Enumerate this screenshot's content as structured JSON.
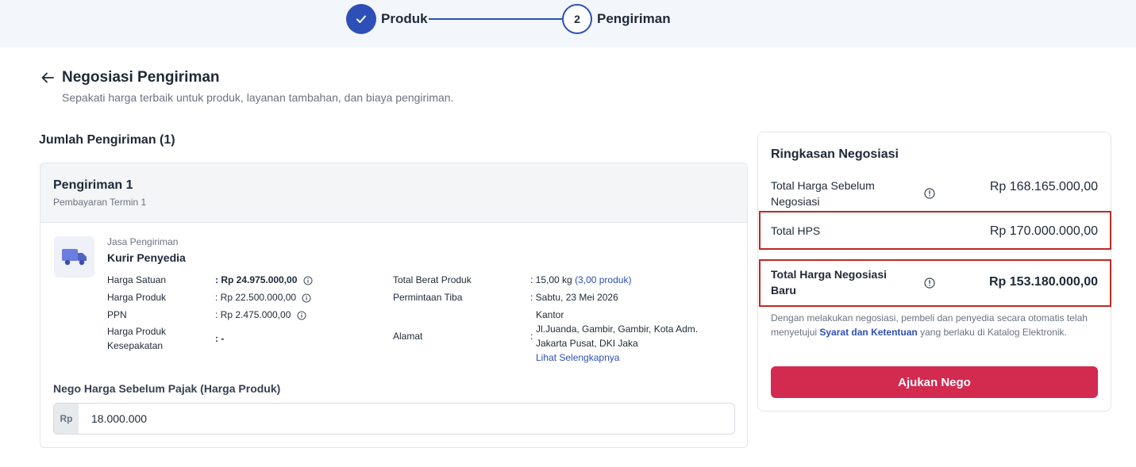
{
  "stepper": {
    "steps": [
      {
        "label": "Produk",
        "state": "done",
        "number": ""
      },
      {
        "label": "Pengiriman",
        "state": "active",
        "number": "2"
      }
    ]
  },
  "header": {
    "title": "Negosiasi Pengiriman",
    "subtitle": "Sepakati harga terbaik untuk produk, layanan tambahan, dan biaya pengiriman."
  },
  "section_title": "Jumlah Pengiriman (1)",
  "shipment": {
    "title": "Pengiriman 1",
    "subtitle": "Pembayaran Termin 1",
    "jasa_label": "Jasa Pengiriman",
    "kurir": "Kurir Penyedia",
    "left_fields": [
      {
        "label": "Harga Satuan",
        "value": ": Rp 24.975.000,00"
      },
      {
        "label": "Harga Produk",
        "value": ": Rp 22.500.000,00"
      },
      {
        "label": "PPN",
        "value": ": Rp 2.475.000,00"
      },
      {
        "label_line1": "Harga Produk",
        "label_line2": "Kesepakatan",
        "value": ": -"
      }
    ],
    "right_fields": {
      "berat_label": "Total Berat Produk",
      "berat_value": ": 15,00 kg",
      "berat_count": "(3,00 produk)",
      "tiba_label": "Permintaan Tiba",
      "tiba_value": ": Sabtu, 23 Mei 2026",
      "alamat_label": "Alamat",
      "alamat_colon": ":",
      "alamat_name": "Kantor",
      "alamat_line1": "Jl.Juanda, Gambir, Gambir, Kota Adm.",
      "alamat_line2": "Jakarta Pusat, DKI Jaka",
      "alamat_link": "Lihat Selengkapnya"
    },
    "nego_label": "Nego Harga Sebelum Pajak (Harga Produk)",
    "nego_prefix": "Rp",
    "nego_value": "18.000.000"
  },
  "summary": {
    "title": "Ringkasan Negosiasi",
    "before_label_1": "Total Harga Sebelum",
    "before_label_2": "Negosiasi",
    "before_value": "Rp 168.165.000,00",
    "hps_label": "Total HPS",
    "hps_value": "Rp 170.000.000,00",
    "new_label_1": "Total Harga Negosiasi",
    "new_label_2": "Baru",
    "new_value": "Rp 153.180.000,00",
    "note_part1": "Dengan melakukan negosiasi, pembeli dan penyedia secara otomatis telah menyetujui",
    "note_link": "Syarat dan Ketentuan",
    "note_part2": "yang berlaku di Katalog Elektronik.",
    "button": "Ajukan Nego"
  },
  "colors": {
    "primary": "#2e4fb8",
    "accent_button": "#d32a50",
    "highlight_border": "#c0281f",
    "stepper_bg": "#f3f7fc"
  }
}
